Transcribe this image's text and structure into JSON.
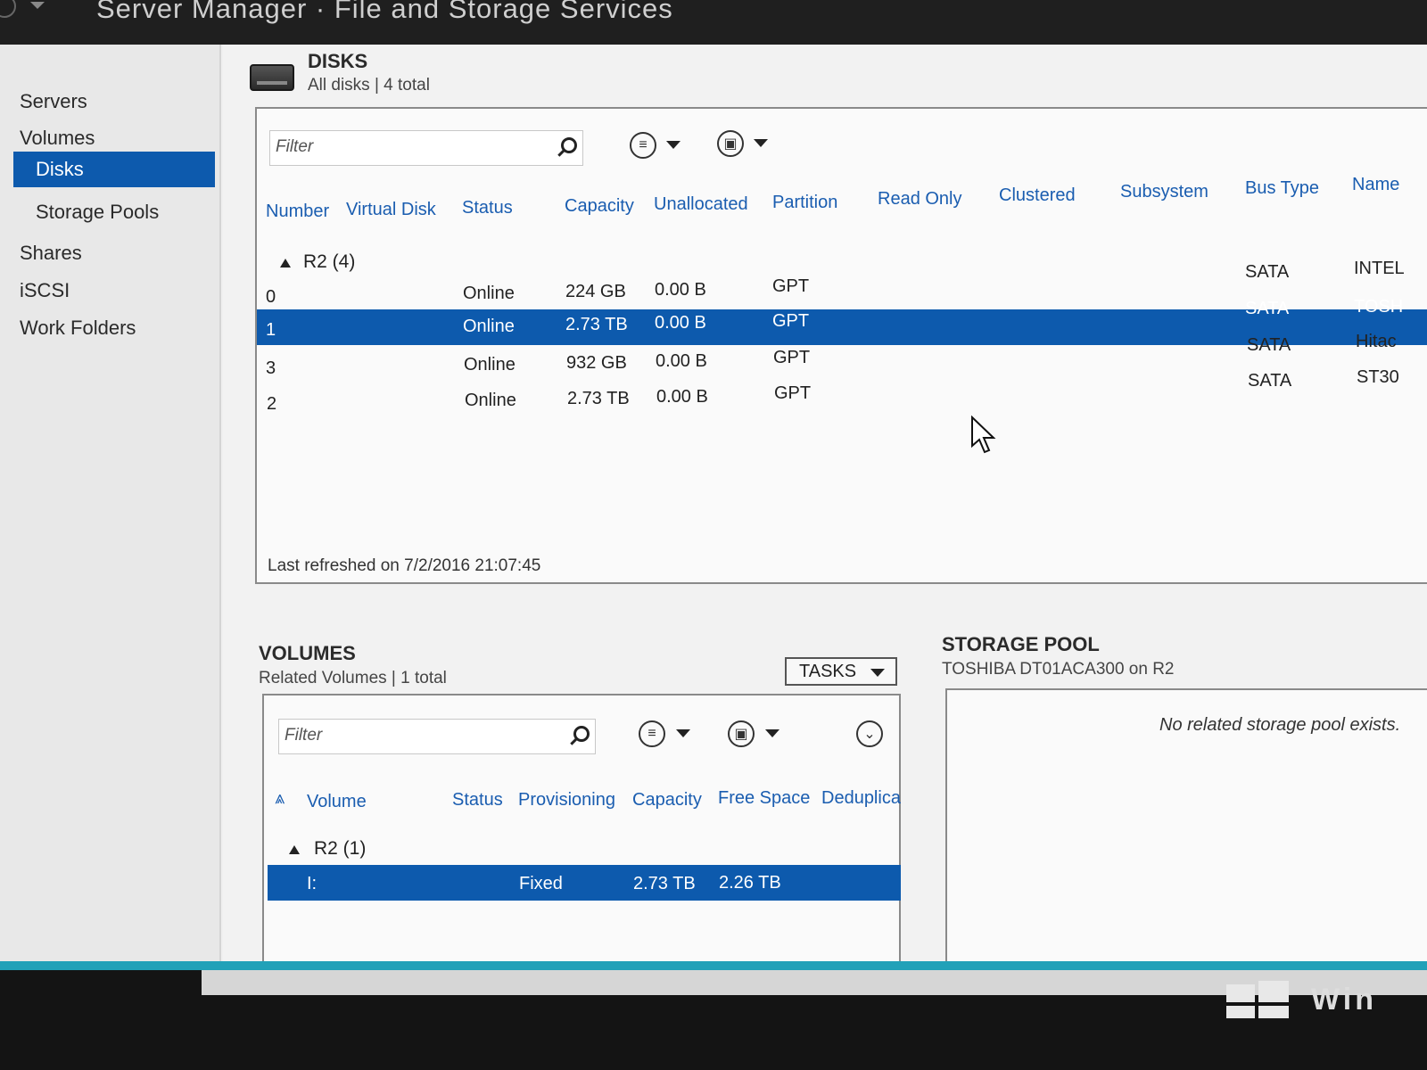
{
  "app": {
    "title": "Server Manager · File and Storage Services"
  },
  "nav": {
    "items": [
      {
        "label": "Servers",
        "selected": false
      },
      {
        "label": "Volumes",
        "selected": false
      },
      {
        "label": "Disks",
        "selected": true
      },
      {
        "label": "Storage Pools",
        "selected": false
      },
      {
        "label": "Shares",
        "selected": false
      },
      {
        "label": "iSCSI",
        "selected": false
      },
      {
        "label": "Work Folders",
        "selected": false
      }
    ]
  },
  "disks": {
    "title": "DISKS",
    "subtitle": "All disks | 4 total",
    "filter_placeholder": "Filter",
    "columns": [
      "Number",
      "Virtual Disk",
      "Status",
      "Capacity",
      "Unallocated",
      "Partition",
      "Read Only",
      "Clustered",
      "Subsystem",
      "Bus Type",
      "Name"
    ],
    "group_label": "R2 (4)",
    "rows": [
      {
        "number": "0",
        "status": "Online",
        "capacity": "224 GB",
        "unallocated": "0.00 B",
        "partition": "GPT",
        "bus_type": "SATA",
        "name": "INTEL"
      },
      {
        "number": "1",
        "status": "Online",
        "capacity": "2.73 TB",
        "unallocated": "0.00 B",
        "partition": "GPT",
        "bus_type": "SATA",
        "name": "TOSH",
        "selected": true
      },
      {
        "number": "3",
        "status": "Online",
        "capacity": "932 GB",
        "unallocated": "0.00 B",
        "partition": "GPT",
        "bus_type": "SATA",
        "name": "Hitac"
      },
      {
        "number": "2",
        "status": "Online",
        "capacity": "2.73 TB",
        "unallocated": "0.00 B",
        "partition": "GPT",
        "bus_type": "SATA",
        "name": "ST30"
      }
    ],
    "last_refreshed": "Last refreshed on 7/2/2016 21:07:45"
  },
  "volumes": {
    "title": "VOLUMES",
    "subtitle": "Related Volumes | 1 total",
    "tasks_label": "TASKS",
    "filter_placeholder": "Filter",
    "columns": [
      "Volume",
      "Status",
      "Provisioning",
      "Capacity",
      "Free Space",
      "Deduplica"
    ],
    "group_label": "R2 (1)",
    "rows": [
      {
        "volume": "I:",
        "provisioning": "Fixed",
        "capacity": "2.73 TB",
        "free_space": "2.26 TB",
        "selected": true
      }
    ]
  },
  "storage_pool": {
    "title": "STORAGE POOL",
    "subtitle": "TOSHIBA DT01ACA300 on R2",
    "empty_message": "No related storage pool exists."
  },
  "taskbar": {
    "brand": "Win"
  },
  "colors": {
    "selection": "#0d5aad",
    "header_text": "#1a5db0",
    "accent_bar": "#21a1b8"
  },
  "icons": [
    "search-icon",
    "list-view-icon",
    "save-icon",
    "expand-icon",
    "sort-icon",
    "cursor-icon",
    "windows-logo-icon"
  ]
}
